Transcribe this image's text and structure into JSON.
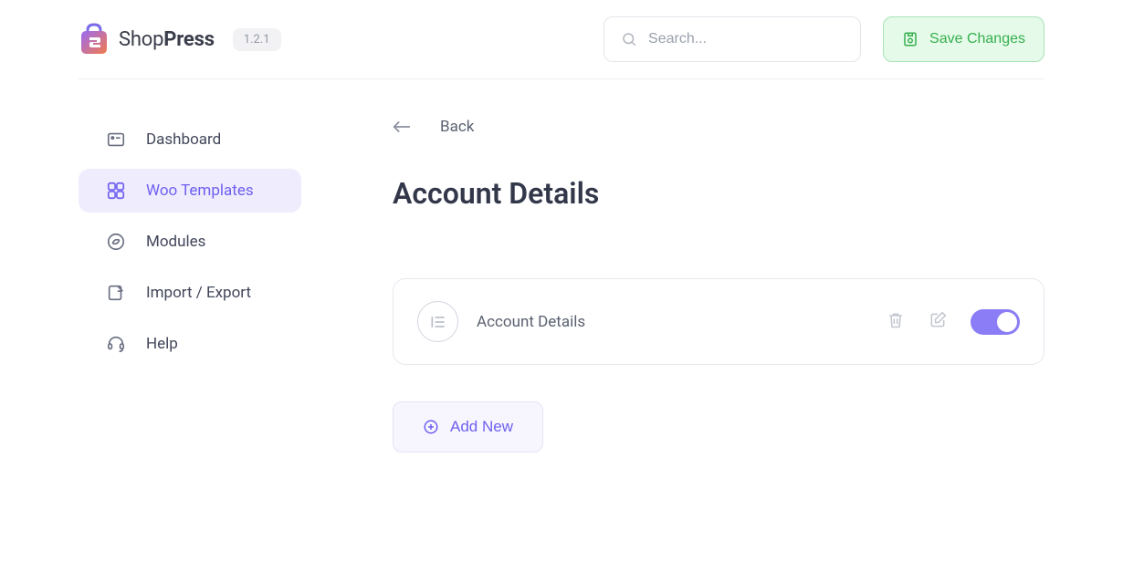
{
  "header": {
    "logo_text_light": "Shop",
    "logo_text_bold": "Press",
    "version": "1.2.1",
    "search_placeholder": "Search...",
    "save_label": "Save Changes"
  },
  "sidebar": {
    "items": [
      {
        "label": "Dashboard"
      },
      {
        "label": "Woo Templates"
      },
      {
        "label": "Modules"
      },
      {
        "label": "Import / Export"
      },
      {
        "label": "Help"
      }
    ]
  },
  "main": {
    "back_label": "Back",
    "page_title": "Account Details",
    "card_title": "Account Details",
    "add_new_label": "Add New"
  }
}
